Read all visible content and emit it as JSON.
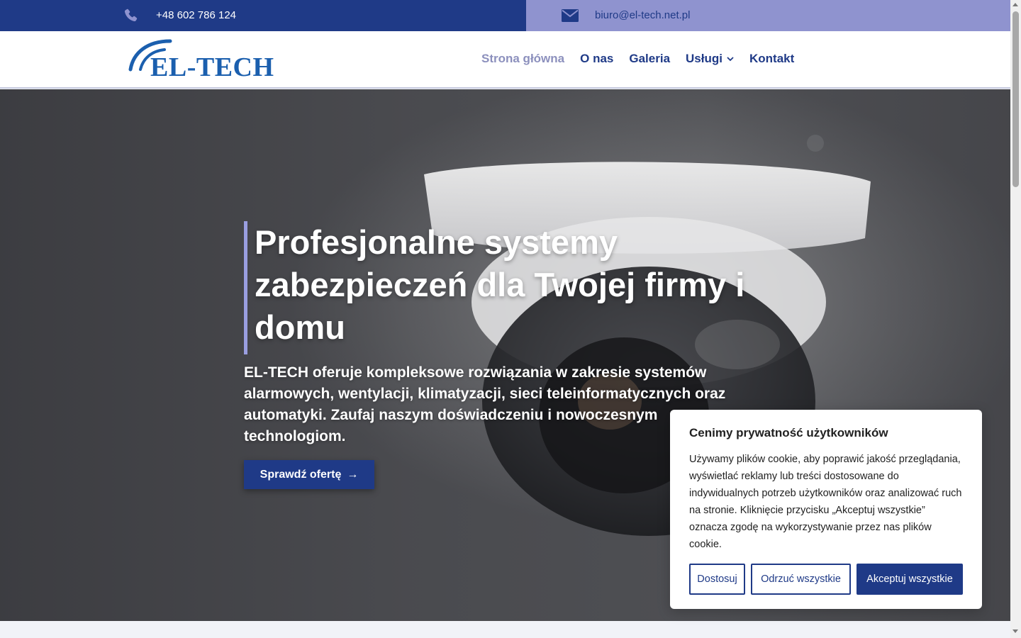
{
  "topbar": {
    "phone": "+48 602 786 124",
    "email": "biuro@el-tech.net.pl",
    "phone_icon": "phone-icon",
    "mail_icon": "envelope-icon"
  },
  "header": {
    "logo_text": "EL-TECH",
    "nav": [
      {
        "label": "Strona główna",
        "active": true
      },
      {
        "label": "O nas"
      },
      {
        "label": "Galeria"
      },
      {
        "label": "Usługi",
        "has_dropdown": true
      },
      {
        "label": "Kontakt"
      }
    ]
  },
  "hero": {
    "title": "Profesjonalne systemy zabezpieczeń dla Twojej firmy i domu",
    "description": "EL-TECH oferuje kompleksowe rozwiązania w zakresie systemów alarmowych, wentylacji, klimatyzacji, sieci teleinformatycznych oraz automatyki. Zaufaj naszym doświadczeniu i nowoczesnym technologiom.",
    "button_label": "Sprawdź ofertę",
    "button_arrow": "→"
  },
  "cookie": {
    "title": "Cenimy prywatność użytkowników",
    "text": "Używamy plików cookie, aby poprawić jakość przeglądania, wyświetlać reklamy lub treści dostosowane do indywidualnych potrzeb użytkowników oraz analizować ruch na stronie. Kliknięcie przycisku „Akceptuj wszystkie” oznacza zgodę na wykorzystywanie przez nas plików cookie.",
    "customize_label": "Dostosuj",
    "reject_label": "Odrzuć wszystkie",
    "accept_label": "Akceptuj wszystkie"
  },
  "colors": {
    "brand_blue": "#1f3a87",
    "accent_lavender": "#8f93cf",
    "logo_blue": "#1b5fae"
  }
}
